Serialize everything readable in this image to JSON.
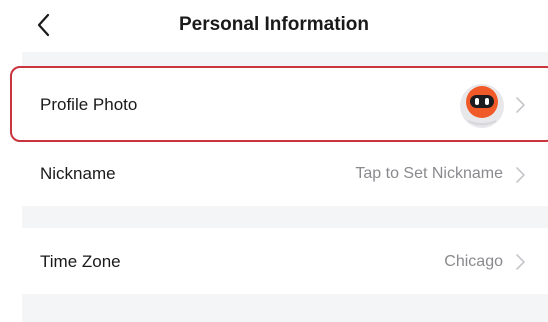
{
  "header": {
    "title": "Personal Information",
    "back_icon": "chevron-left-icon"
  },
  "rows": [
    {
      "label": "Profile Photo",
      "value": "",
      "icon": "robot-avatar",
      "selected": true
    },
    {
      "label": "Nickname",
      "value": "Tap to Set Nickname"
    },
    {
      "label": "Time Zone",
      "value": "Chicago"
    }
  ],
  "colors": {
    "highlight": "#c9343d",
    "separator_bg": "#f4f5f7",
    "secondary_text": "#8a8a8e",
    "avatar_orange": "#f05a28"
  }
}
